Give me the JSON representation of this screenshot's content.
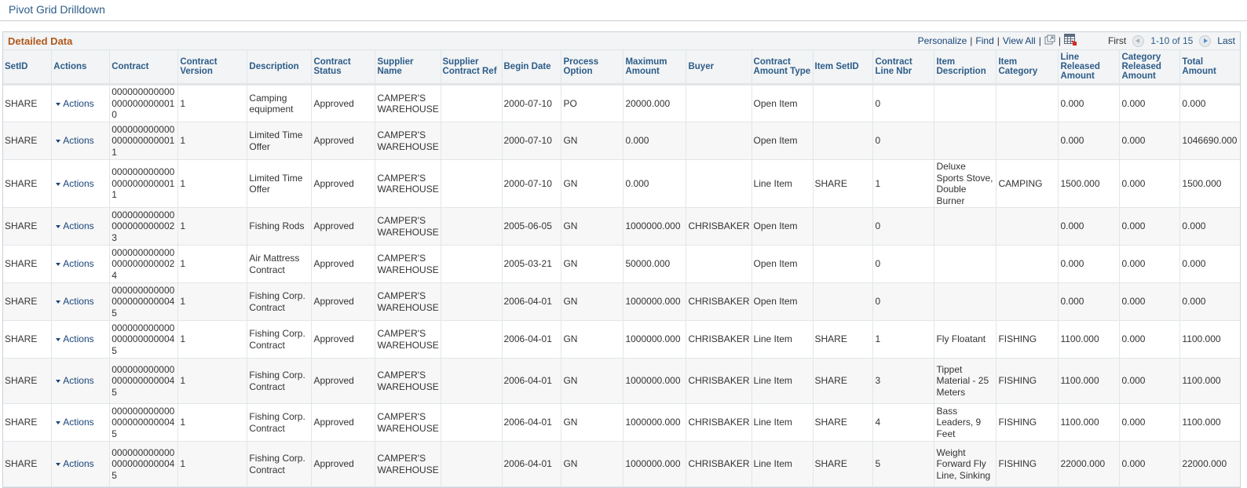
{
  "page": {
    "title": "Pivot Grid Drilldown"
  },
  "grid": {
    "title": "Detailed Data",
    "toolbar": {
      "personalize": "Personalize",
      "find": "Find",
      "view_all": "View All",
      "separator": "|",
      "new_window_icon": "new-window-icon",
      "download_icon": "download-to-excel-icon",
      "first": "First",
      "range": "1-10 of 15",
      "last": "Last"
    },
    "columns": [
      "SetID",
      "Actions",
      "Contract",
      "Contract Version",
      "Description",
      "Contract Status",
      "Supplier Name",
      "Supplier Contract Ref",
      "Begin Date",
      "Process Option",
      "Maximum Amount",
      "Buyer",
      "Contract Amount Type",
      "Item SetID",
      "Contract Line Nbr",
      "Item Description",
      "Item Category",
      "Line Released Amount",
      "Category Released Amount",
      "Total Amount"
    ],
    "rows": [
      {
        "setid": "SHARE",
        "actions": "Actions",
        "contract": "0000000000000000000000010",
        "version": "1",
        "description": "Camping equipment",
        "status": "Approved",
        "supplier": "CAMPER'S WAREHOUSE",
        "supplier_ref": "",
        "begin_date": "2000-07-10",
        "process_option": "PO",
        "max_amount": "20000.000",
        "buyer": "",
        "amount_type": "Open Item",
        "item_setid": "",
        "line_nbr": "0",
        "item_description": "",
        "item_category": "",
        "line_released": "0.000",
        "category_released": "0.000",
        "total": "0.000"
      },
      {
        "setid": "SHARE",
        "actions": "Actions",
        "contract": "0000000000000000000000011",
        "version": "1",
        "description": "Limited Time Offer",
        "status": "Approved",
        "supplier": "CAMPER'S WAREHOUSE",
        "supplier_ref": "",
        "begin_date": "2000-07-10",
        "process_option": "GN",
        "max_amount": "0.000",
        "buyer": "",
        "amount_type": "Open Item",
        "item_setid": "",
        "line_nbr": "0",
        "item_description": "",
        "item_category": "",
        "line_released": "0.000",
        "category_released": "0.000",
        "total": "1046690.000"
      },
      {
        "setid": "SHARE",
        "actions": "Actions",
        "contract": "0000000000000000000000011",
        "version": "1",
        "description": "Limited Time Offer",
        "status": "Approved",
        "supplier": "CAMPER'S WAREHOUSE",
        "supplier_ref": "",
        "begin_date": "2000-07-10",
        "process_option": "GN",
        "max_amount": "0.000",
        "buyer": "",
        "amount_type": "Line Item",
        "item_setid": "SHARE",
        "line_nbr": "1",
        "item_description": "Deluxe Sports Stove, Double Burner",
        "item_category": "CAMPING",
        "line_released": "1500.000",
        "category_released": "0.000",
        "total": "1500.000"
      },
      {
        "setid": "SHARE",
        "actions": "Actions",
        "contract": "0000000000000000000000023",
        "version": "1",
        "description": "Fishing Rods",
        "status": "Approved",
        "supplier": "CAMPER'S WAREHOUSE",
        "supplier_ref": "",
        "begin_date": "2005-06-05",
        "process_option": "GN",
        "max_amount": "1000000.000",
        "buyer": "CHRISBAKER",
        "amount_type": "Open Item",
        "item_setid": "",
        "line_nbr": "0",
        "item_description": "",
        "item_category": "",
        "line_released": "0.000",
        "category_released": "0.000",
        "total": "0.000"
      },
      {
        "setid": "SHARE",
        "actions": "Actions",
        "contract": "0000000000000000000000024",
        "version": "1",
        "description": "Air Mattress Contract",
        "status": "Approved",
        "supplier": "CAMPER'S WAREHOUSE",
        "supplier_ref": "",
        "begin_date": "2005-03-21",
        "process_option": "GN",
        "max_amount": "50000.000",
        "buyer": "",
        "amount_type": "Open Item",
        "item_setid": "",
        "line_nbr": "0",
        "item_description": "",
        "item_category": "",
        "line_released": "0.000",
        "category_released": "0.000",
        "total": "0.000"
      },
      {
        "setid": "SHARE",
        "actions": "Actions",
        "contract": "0000000000000000000000045",
        "version": "1",
        "description": "Fishing Corp. Contract",
        "status": "Approved",
        "supplier": "CAMPER'S WAREHOUSE",
        "supplier_ref": "",
        "begin_date": "2006-04-01",
        "process_option": "GN",
        "max_amount": "1000000.000",
        "buyer": "CHRISBAKER",
        "amount_type": "Open Item",
        "item_setid": "",
        "line_nbr": "0",
        "item_description": "",
        "item_category": "",
        "line_released": "0.000",
        "category_released": "0.000",
        "total": "0.000"
      },
      {
        "setid": "SHARE",
        "actions": "Actions",
        "contract": "0000000000000000000000045",
        "version": "1",
        "description": "Fishing Corp. Contract",
        "status": "Approved",
        "supplier": "CAMPER'S WAREHOUSE",
        "supplier_ref": "",
        "begin_date": "2006-04-01",
        "process_option": "GN",
        "max_amount": "1000000.000",
        "buyer": "CHRISBAKER",
        "amount_type": "Line Item",
        "item_setid": "SHARE",
        "line_nbr": "1",
        "item_description": "Fly Floatant",
        "item_category": "FISHING",
        "line_released": "1100.000",
        "category_released": "0.000",
        "total": "1100.000"
      },
      {
        "setid": "SHARE",
        "actions": "Actions",
        "contract": "0000000000000000000000045",
        "version": "1",
        "description": "Fishing Corp. Contract",
        "status": "Approved",
        "supplier": "CAMPER'S WAREHOUSE",
        "supplier_ref": "",
        "begin_date": "2006-04-01",
        "process_option": "GN",
        "max_amount": "1000000.000",
        "buyer": "CHRISBAKER",
        "amount_type": "Line Item",
        "item_setid": "SHARE",
        "line_nbr": "3",
        "item_description": "Tippet Material - 25 Meters",
        "item_category": "FISHING",
        "line_released": "1100.000",
        "category_released": "0.000",
        "total": "1100.000"
      },
      {
        "setid": "SHARE",
        "actions": "Actions",
        "contract": "0000000000000000000000045",
        "version": "1",
        "description": "Fishing Corp. Contract",
        "status": "Approved",
        "supplier": "CAMPER'S WAREHOUSE",
        "supplier_ref": "",
        "begin_date": "2006-04-01",
        "process_option": "GN",
        "max_amount": "1000000.000",
        "buyer": "CHRISBAKER",
        "amount_type": "Line Item",
        "item_setid": "SHARE",
        "line_nbr": "4",
        "item_description": "Bass Leaders, 9 Feet",
        "item_category": "FISHING",
        "line_released": "1100.000",
        "category_released": "0.000",
        "total": "1100.000"
      },
      {
        "setid": "SHARE",
        "actions": "Actions",
        "contract": "0000000000000000000000045",
        "version": "1",
        "description": "Fishing Corp. Contract",
        "status": "Approved",
        "supplier": "CAMPER'S WAREHOUSE",
        "supplier_ref": "",
        "begin_date": "2006-04-01",
        "process_option": "GN",
        "max_amount": "1000000.000",
        "buyer": "CHRISBAKER",
        "amount_type": "Line Item",
        "item_setid": "SHARE",
        "line_nbr": "5",
        "item_description": "Weight Forward Fly Line, Sinking",
        "item_category": "FISHING",
        "line_released": "22000.000",
        "category_released": "0.000",
        "total": "22000.000"
      }
    ]
  }
}
